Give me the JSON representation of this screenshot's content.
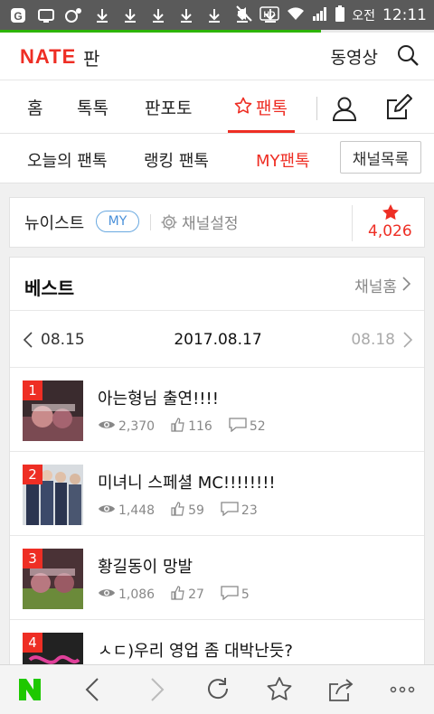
{
  "status_bar": {
    "left_icons": [
      "g-icon",
      "monitor-icon",
      "camera-icon",
      "download-icon",
      "download-icon",
      "download-icon",
      "download-icon",
      "download-icon",
      "download-icon",
      "download-icon"
    ],
    "right_icons": [
      "mute-icon",
      "hd-icon",
      "wifi-icon",
      "signal-icon",
      "battery-icon"
    ],
    "ampm": "오전",
    "time": "12:11"
  },
  "loading_progress": 0.74,
  "header": {
    "logo": "NATE",
    "section": "판",
    "video_link": "동영상"
  },
  "tabs": [
    {
      "label": "홈"
    },
    {
      "label": "톡톡"
    },
    {
      "label": "판포토"
    },
    {
      "label": "팬톡",
      "active": true
    }
  ],
  "sub_tabs": [
    {
      "label": "오늘의 팬톡"
    },
    {
      "label": "랭킹 팬톡"
    },
    {
      "label": "MY팬톡",
      "active": true
    }
  ],
  "channel_list_button": "채널목록",
  "channel": {
    "name": "뉴이스트",
    "badge": "MY",
    "settings_label": "채널설정",
    "star_count": "4,026"
  },
  "best": {
    "title": "베스트",
    "channel_home": "채널홈",
    "prev_date": "08.15",
    "current_date": "2017.08.17",
    "next_date": "08.18",
    "items": [
      {
        "rank": "1",
        "title": "아는형님 출연!!!!",
        "views": "2,370",
        "likes": "116",
        "comments": "52"
      },
      {
        "rank": "2",
        "title": "미녀니 스페셜 MC!!!!!!!!",
        "views": "1,448",
        "likes": "59",
        "comments": "23"
      },
      {
        "rank": "3",
        "title": "황길동이 망발",
        "views": "1,086",
        "likes": "27",
        "comments": "5"
      },
      {
        "rank": "4",
        "title": "ㅅㄷ)우리 영업 좀 대박난듯?",
        "views": "",
        "likes": "",
        "comments": ""
      }
    ]
  },
  "bottom_bar": [
    "naver-n-icon",
    "back-icon",
    "forward-icon",
    "refresh-icon",
    "bookmark-star-icon",
    "share-icon",
    "more-icon"
  ],
  "colors": {
    "accent": "#ee2e24",
    "my_badge": "#4a90d9",
    "naver_green": "#1ec800",
    "progress": "#2db400"
  }
}
